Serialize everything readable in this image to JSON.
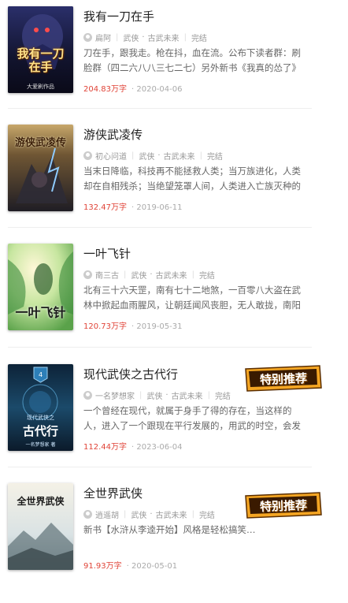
{
  "books": [
    {
      "title": "我有一刀在手",
      "author": "扁阿",
      "genre": "武侠",
      "subgenre": "古武未来",
      "status": "完结",
      "description": "刀在手，跟我走。枪在抖，血在流。公布下读者群：刷脸群（四二六八八三七二七）另外新书《我真的怂了》",
      "word_count": "204.83万字",
      "date": "2020-04-06",
      "cover_text": "我有一刀在手",
      "cover_sub": "大爱刷作品",
      "featured": false
    },
    {
      "title": "游侠武凌传",
      "author": "初心问道",
      "genre": "武侠",
      "subgenre": "古武未来",
      "status": "完结",
      "description": "当末日降临，科技再不能拯救人类；当万族进化，人类却在自相残杀；当绝望笼罩人间，人类进入亡族灭种的",
      "word_count": "132.47万字",
      "date": "2019-06-11",
      "cover_text": "游侠武凌传",
      "featured": false
    },
    {
      "title": "一叶飞针",
      "author": "南三古",
      "genre": "武侠",
      "subgenre": "古武未来",
      "status": "完结",
      "description": "北有三十六天罡，南有七十二地煞，一百零八大盗在武林中掀起血雨腥风，让朝廷闻风丧胆，无人敢拢，南阳",
      "word_count": "120.73万字",
      "date": "2019-05-31",
      "cover_text": "一叶飞针",
      "featured": false
    },
    {
      "title": "现代武侠之古代行",
      "author": "一名梦想家",
      "genre": "武侠",
      "subgenre": "古武未来",
      "status": "完结",
      "description": "一个曾经在现代，就属于身手了得的存在，当这样的人，进入了一个跟现在平行发展的，用武的时空，会发",
      "word_count": "112.44万字",
      "date": "2023-06-04",
      "cover_text": "古代行",
      "cover_top": "现代武侠之",
      "cover_author": "一名梦想家 著",
      "featured": true,
      "badge_text": "特别推荐"
    },
    {
      "title": "全世界武侠",
      "author": "逍遥胡",
      "genre": "武侠",
      "subgenre": "古武未来",
      "status": "完结",
      "description": "新书【水浒从李逵开始】风格是轻松搞笑…",
      "word_count": "91.93万字",
      "date": "2020-05-01",
      "cover_text": "全世界武侠",
      "featured": true,
      "badge_text": "特别推荐"
    }
  ]
}
